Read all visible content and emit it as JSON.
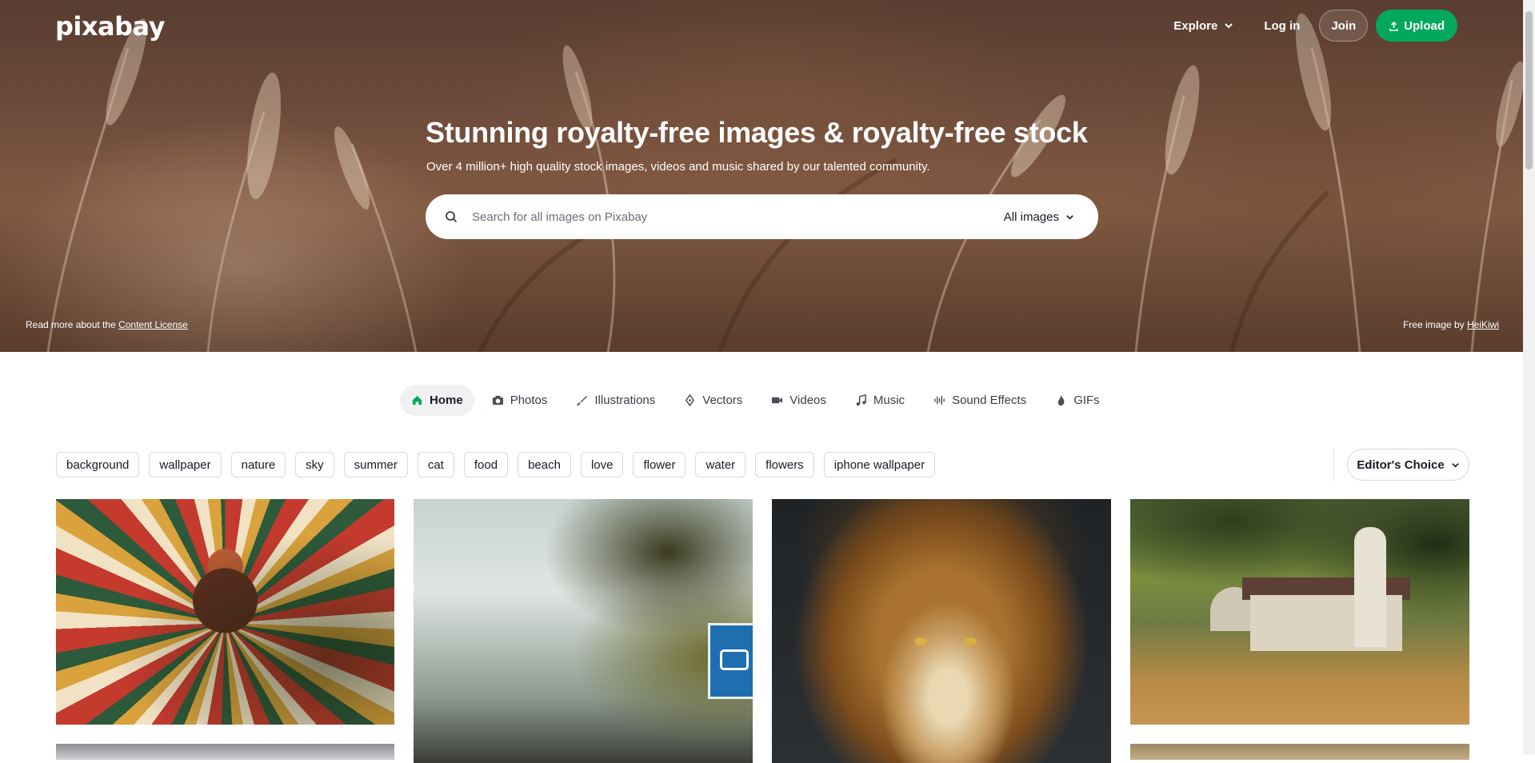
{
  "brand": {
    "logo_text": "pixabay"
  },
  "topnav": {
    "explore_label": "Explore",
    "login_label": "Log in",
    "join_label": "Join",
    "upload_label": "Upload"
  },
  "hero": {
    "title": "Stunning royalty-free images & royalty-free stock",
    "subtitle": "Over 4 million+ high quality stock images, videos and music shared by our talented community.",
    "license_prefix": "Read more about the ",
    "license_link": "Content License",
    "credit_prefix": "Free image by ",
    "credit_author": "HeiKiwi"
  },
  "search": {
    "placeholder": "Search for all images on Pixabay",
    "scope_label": "All images"
  },
  "tabs": [
    {
      "label": "Home",
      "icon": "home-icon",
      "active": true
    },
    {
      "label": "Photos",
      "icon": "camera-icon"
    },
    {
      "label": "Illustrations",
      "icon": "brush-icon"
    },
    {
      "label": "Vectors",
      "icon": "pen-nib-icon"
    },
    {
      "label": "Videos",
      "icon": "video-camera-icon"
    },
    {
      "label": "Music",
      "icon": "music-note-icon"
    },
    {
      "label": "Sound Effects",
      "icon": "waveform-icon"
    },
    {
      "label": "GIFs",
      "icon": "flame-icon"
    }
  ],
  "tags": [
    "background",
    "wallpaper",
    "nature",
    "sky",
    "summer",
    "cat",
    "food",
    "beach",
    "love",
    "flower",
    "water",
    "flowers",
    "iphone wallpaper"
  ],
  "sort": {
    "label": "Editor's Choice"
  },
  "colors": {
    "accent": "#02a95c",
    "text": "#191b26"
  }
}
